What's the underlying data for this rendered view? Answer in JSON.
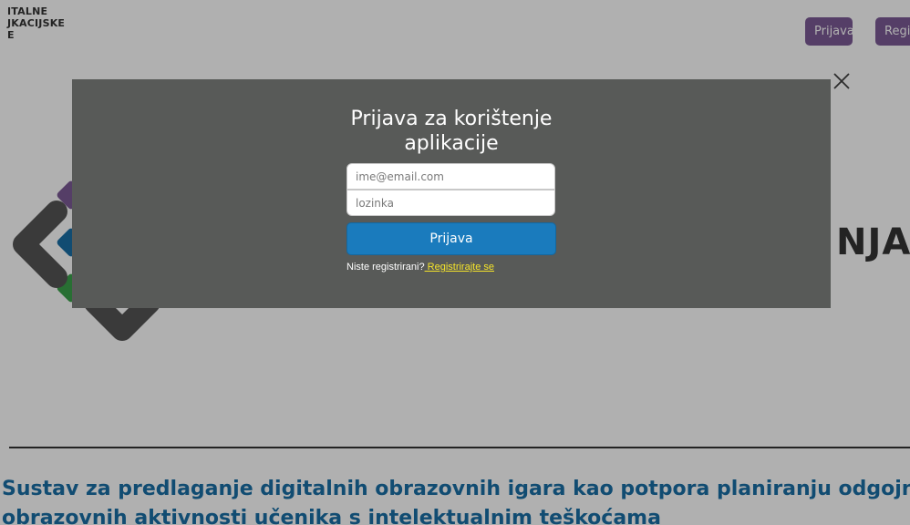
{
  "header": {
    "logo_text": "ITALNE\nJKACIJSKE\nE",
    "login_label": "Prijava",
    "register_label": "Regi"
  },
  "hero": {
    "text": "NJA"
  },
  "page": {
    "title_line1": "Sustav za predlaganje digitalnih obrazovnih igara kao potpora planiranju odgojno-",
    "title_line2": "obrazovnih aktivnosti učenika s intelektualnim teškoćama"
  },
  "modal": {
    "title_line1": "Prijava za korištenje",
    "title_line2": "aplikacije",
    "email_placeholder": "ime@email.com",
    "password_placeholder": "lozinka",
    "submit_label": "Prijava",
    "register_prompt": "Niste registrirani?",
    "register_link": " Registrirajte se"
  },
  "colors": {
    "nav_button": "#7c5b96",
    "modal_bg": "#585a58",
    "submit_button": "#1a7bbd",
    "link": "#f5e42a",
    "title": "#1a6fa6"
  },
  "icons": {
    "close": "close-icon",
    "hero": "chevron-logo-graphic"
  }
}
